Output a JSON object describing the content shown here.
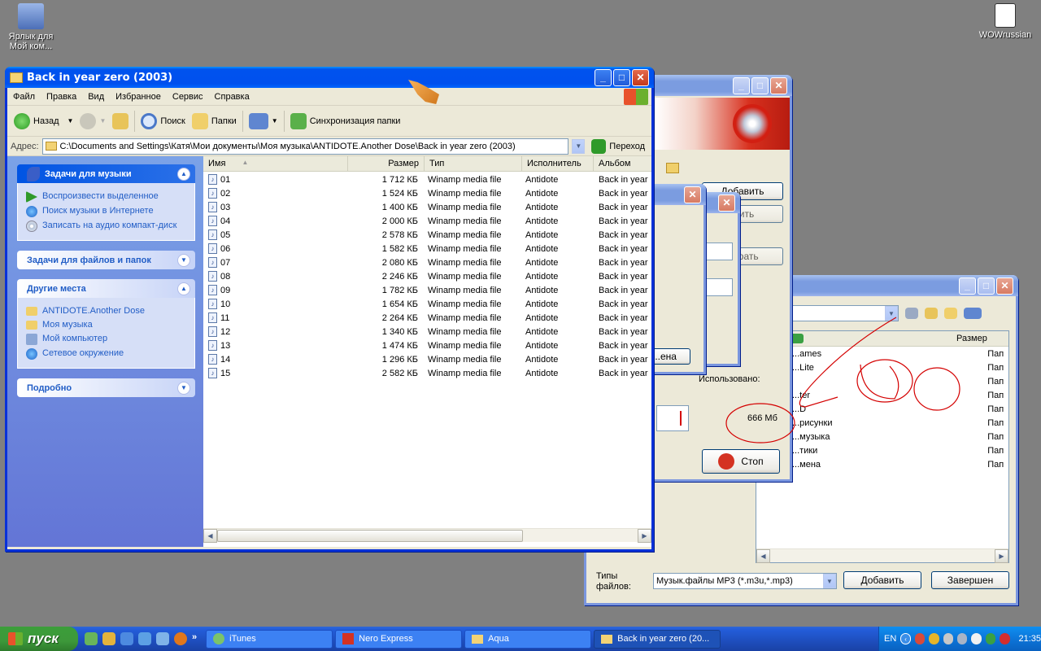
{
  "desktop": {
    "icons": [
      {
        "label": "Ярлык для Мой ком..."
      },
      {
        "label": "WOWrussian"
      }
    ]
  },
  "explorer": {
    "title": "Back in year zero (2003)",
    "menu": [
      "Файл",
      "Правка",
      "Вид",
      "Избранное",
      "Сервис",
      "Справка"
    ],
    "toolbar": {
      "back": "Назад",
      "search": "Поиск",
      "folders": "Папки",
      "sync": "Синхронизация папки"
    },
    "address": {
      "label": "Адрес:",
      "value": "C:\\Documents and Settings\\Катя\\Мои документы\\Моя музыка\\ANTIDOTE.Another Dose\\Back in year zero (2003)",
      "go": "Переход"
    },
    "tasks": {
      "music_header": "Задачи для музыки",
      "music_items": [
        "Воспроизвести выделенное",
        "Поиск музыки в Интернете",
        "Записать на аудио компакт-диск"
      ],
      "files_header": "Задачи для файлов и папок",
      "places_header": "Другие места",
      "places_items": [
        "ANTIDOTE.Another Dose",
        "Моя музыка",
        "Мой компьютер",
        "Сетевое окружение"
      ],
      "details_header": "Подробно"
    },
    "columns": [
      "Имя",
      "Размер",
      "Тип",
      "Исполнитель",
      "Альбом"
    ],
    "files": [
      {
        "name": "01",
        "size": "1 712 КБ",
        "type": "Winamp media file",
        "artist": "Antidote",
        "album": "Back in year"
      },
      {
        "name": "02",
        "size": "1 524 КБ",
        "type": "Winamp media file",
        "artist": "Antidote",
        "album": "Back in year"
      },
      {
        "name": "03",
        "size": "1 400 КБ",
        "type": "Winamp media file",
        "artist": "Antidote",
        "album": "Back in year"
      },
      {
        "name": "04",
        "size": "2 000 КБ",
        "type": "Winamp media file",
        "artist": "Antidote",
        "album": "Back in year"
      },
      {
        "name": "05",
        "size": "2 578 КБ",
        "type": "Winamp media file",
        "artist": "Antidote",
        "album": "Back in year"
      },
      {
        "name": "06",
        "size": "1 582 КБ",
        "type": "Winamp media file",
        "artist": "Antidote",
        "album": "Back in year"
      },
      {
        "name": "07",
        "size": "2 080 КБ",
        "type": "Winamp media file",
        "artist": "Antidote",
        "album": "Back in year"
      },
      {
        "name": "08",
        "size": "2 246 КБ",
        "type": "Winamp media file",
        "artist": "Antidote",
        "album": "Back in year"
      },
      {
        "name": "09",
        "size": "1 782 КБ",
        "type": "Winamp media file",
        "artist": "Antidote",
        "album": "Back in year"
      },
      {
        "name": "10",
        "size": "1 654 КБ",
        "type": "Winamp media file",
        "artist": "Antidote",
        "album": "Back in year"
      },
      {
        "name": "11",
        "size": "2 264 КБ",
        "type": "Winamp media file",
        "artist": "Antidote",
        "album": "Back in year"
      },
      {
        "name": "12",
        "size": "1 340 КБ",
        "type": "Winamp media file",
        "artist": "Antidote",
        "album": "Back in year"
      },
      {
        "name": "13",
        "size": "1 474 КБ",
        "type": "Winamp media file",
        "artist": "Antidote",
        "album": "Back in year"
      },
      {
        "name": "14",
        "size": "1 296 КБ",
        "type": "Winamp media file",
        "artist": "Antidote",
        "album": "Back in year"
      },
      {
        "name": "15",
        "size": "2 582 КБ",
        "type": "Winamp media file",
        "artist": "Antidote",
        "album": "Back in year"
      }
    ]
  },
  "nero": {
    "add_button": "Добавить",
    "remove_button": "...ить",
    "burn_button": "...грать",
    "used_label": "Использовано:",
    "used_value": "666 Мб",
    "stop_button": "Стоп",
    "cancel_partial": "...ена"
  },
  "open_dialog": {
    "size_col": "Размер",
    "items": [
      {
        "name": "...ames",
        "type": "Пап"
      },
      {
        "name": "...Lite",
        "type": "Пап"
      },
      {
        "name": "",
        "type": "Пап"
      },
      {
        "name": "...ter",
        "type": "Пап"
      },
      {
        "name": "...D",
        "type": "Пап"
      },
      {
        "name": "...рисунки",
        "type": "Пап"
      },
      {
        "name": "...музыка",
        "type": "Пап"
      },
      {
        "name": "...тики",
        "type": "Пап"
      },
      {
        "name": "...мена",
        "type": "Пап"
      }
    ],
    "filetypes_label": "Типы файлов:",
    "filetypes_value": "Музык.файлы MP3 (*.m3u,*.mp3)",
    "add_button": "Добавить",
    "finish_button": "Завершен"
  },
  "taskbar": {
    "start": "пуск",
    "tasks": [
      {
        "label": "iTunes",
        "active": false
      },
      {
        "label": "Nero Express",
        "active": false
      },
      {
        "label": "Aqua",
        "active": false
      },
      {
        "label": "Back in year zero (20...",
        "active": true
      }
    ],
    "lang": "EN",
    "clock": "21:35"
  },
  "colors": {
    "xp_blue": "#0054e3",
    "start_green": "#3d983a",
    "annotation_red": "#d40000"
  }
}
